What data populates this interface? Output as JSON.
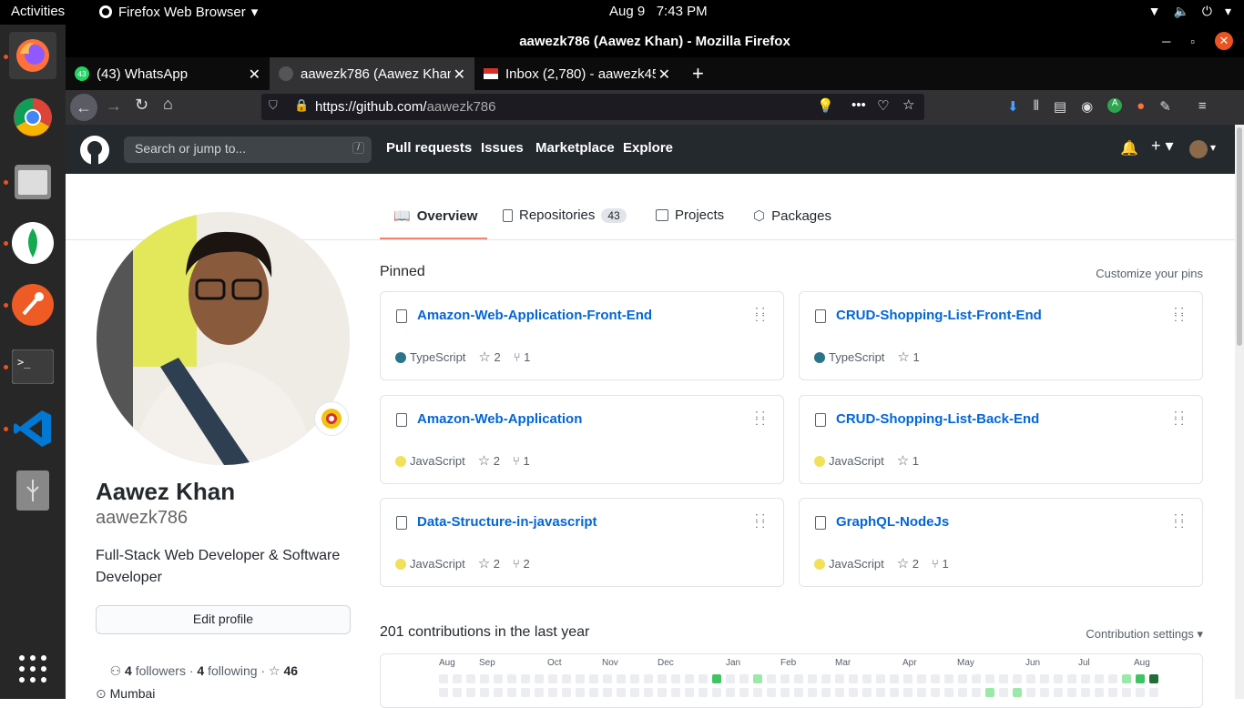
{
  "topbar": {
    "activities": "Activities",
    "app": "Firefox Web Browser",
    "date": "Aug 9",
    "time": "7:43 PM"
  },
  "window": {
    "title": "aawezk786 (Aawez Khan) - Mozilla Firefox"
  },
  "tabs": [
    {
      "label": "(43) WhatsApp",
      "badge": "43"
    },
    {
      "label": "aawezk786 (Aawez Khan"
    },
    {
      "label": "Inbox (2,780) - aawezk45"
    }
  ],
  "address": {
    "prefix": "https://github.com/",
    "path": "aawezk786"
  },
  "github": {
    "search_placeholder": "Search or jump to...",
    "slash": "/",
    "nav": [
      "Pull requests",
      "Issues",
      "Marketplace",
      "Explore"
    ]
  },
  "profile": {
    "name": "Aawez Khan",
    "username": "aawezk786",
    "bio": "Full-Stack Web Developer & Software Developer",
    "edit": "Edit profile",
    "followers_count": "4",
    "followers_label": "followers",
    "sep": " · ",
    "following_count": "4",
    "following_label": "following",
    "sep2": " · ",
    "stars": "46",
    "location": "Mumbai"
  },
  "usertabs": {
    "overview": "Overview",
    "repositories": "Repositories",
    "repo_count": "43",
    "projects": "Projects",
    "packages": "Packages"
  },
  "pinned": {
    "title": "Pinned",
    "customize": "Customize your pins"
  },
  "repos": [
    {
      "name": "Amazon-Web-Application-Front-End",
      "lang": "TypeScript",
      "color": "#2b7489",
      "stars": "2",
      "forks": "1"
    },
    {
      "name": "CRUD-Shopping-List-Front-End",
      "lang": "TypeScript",
      "color": "#2b7489",
      "stars": "1",
      "forks": ""
    },
    {
      "name": "Amazon-Web-Application",
      "lang": "JavaScript",
      "color": "#f1e05a",
      "stars": "2",
      "forks": "1"
    },
    {
      "name": "CRUD-Shopping-List-Back-End",
      "lang": "JavaScript",
      "color": "#f1e05a",
      "stars": "1",
      "forks": ""
    },
    {
      "name": "Data-Structure-in-javascript",
      "lang": "JavaScript",
      "color": "#f1e05a",
      "stars": "2",
      "forks": "2"
    },
    {
      "name": "GraphQL-NodeJs",
      "lang": "JavaScript",
      "color": "#f1e05a",
      "stars": "2",
      "forks": "1"
    }
  ],
  "contrib": {
    "title": "201 contributions in the last year",
    "settings": "Contribution settings",
    "months": [
      "Aug",
      "Sep",
      "Oct",
      "Nov",
      "Dec",
      "Jan",
      "Feb",
      "Mar",
      "Apr",
      "May",
      "Jun",
      "Jul",
      "Aug"
    ]
  }
}
